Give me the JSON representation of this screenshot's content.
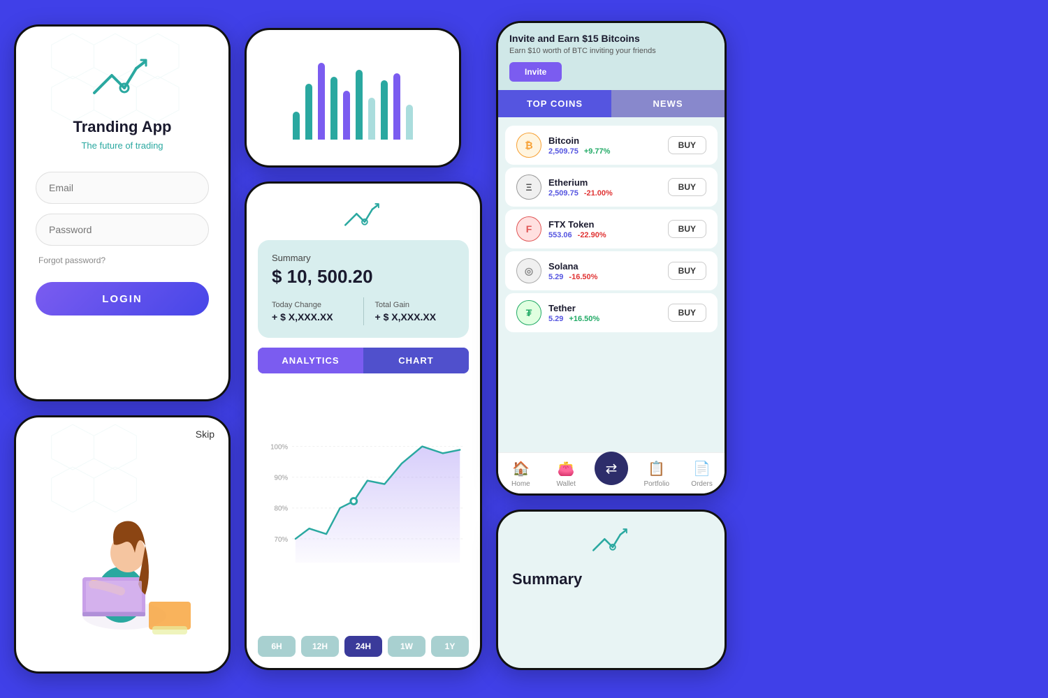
{
  "bg_color": "#4040e8",
  "login": {
    "title": "Tranding App",
    "subtitle": "The future of trading",
    "email_placeholder": "Email",
    "password_placeholder": "Password",
    "forgot": "Forgot password?",
    "login_btn": "LOGIN"
  },
  "onboard": {
    "skip": "Skip"
  },
  "analytics": {
    "logo_alt": "trading-logo",
    "summary_label": "Summary",
    "amount": "$ 10, 500.20",
    "today_label": "Today Change",
    "today_val": "+ $ X,XXX.XX",
    "total_label": "Total Gain",
    "total_val": "+ $ X,XXX.XX",
    "tabs": [
      "ANALYTICS",
      "CHART"
    ],
    "active_tab": "ANALYTICS",
    "y_labels": [
      "100%",
      "90%",
      "80%",
      "70%"
    ],
    "time_filters": [
      "6H",
      "12H",
      "24H",
      "1W",
      "1Y"
    ],
    "active_filter": "24H"
  },
  "top_coins": {
    "invite_title": "Invite and Earn $15 Bitcoins",
    "invite_sub": "Earn $10 worth of BTC inviting your friends",
    "invite_btn": "Invite",
    "tabs": [
      "TOP COINS",
      "NEWS"
    ],
    "active_tab": "TOP COINS",
    "coins": [
      {
        "name": "Bitcoin",
        "price": "2,509.75",
        "change": "+9.77%",
        "positive": true,
        "color": "#f7a033",
        "letter": "₿"
      },
      {
        "name": "Etherium",
        "price": "2,509.75",
        "change": "-21.00%",
        "positive": false,
        "color": "#555",
        "letter": "Ξ"
      },
      {
        "name": "FTX Token",
        "price": "553.06",
        "change": "-22.90%",
        "positive": false,
        "color": "#e05555",
        "letter": "F"
      },
      {
        "name": "Solana",
        "price": "5.29",
        "change": "-16.50%",
        "positive": false,
        "color": "#aaa",
        "letter": "◎"
      },
      {
        "name": "Tether",
        "price": "5.29",
        "change": "+16.50%",
        "positive": true,
        "color": "#22aa66",
        "letter": "₮"
      }
    ],
    "buy_label": "BUY",
    "nav": [
      "Home",
      "Wallet",
      "",
      "Portfolio",
      "Orders"
    ]
  },
  "summary_small": {
    "text": "Summary"
  }
}
